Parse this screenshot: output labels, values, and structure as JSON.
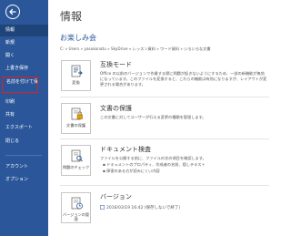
{
  "sidebar": {
    "items": [
      {
        "label": "情報"
      },
      {
        "label": "新規"
      },
      {
        "label": "開く"
      },
      {
        "label": "上書き保存"
      },
      {
        "label": "名前を付けて保存"
      },
      {
        "label": "印刷"
      },
      {
        "label": "共有"
      },
      {
        "label": "エクスポート"
      },
      {
        "label": "閉じる"
      },
      {
        "label": "アカウント"
      },
      {
        "label": "オプション"
      }
    ]
  },
  "main": {
    "title": "情報",
    "section_title": "お楽しみ会",
    "path": "C: » Users » yasukonatu » SkyDrive » レッスン資料 » ワード資料 » いろいろな文書",
    "compat": {
      "title": "互換モード",
      "button_label": "変換",
      "desc": "Office の以前のバージョンで作業する際に問題が起きないようにするため、一部の新機能が無効になっています。このファイルを変換すると、これらの機能は有効になりますが、レイアウトが変更される場合があります。"
    },
    "protect": {
      "title": "文書の保護",
      "button_label": "文書の保護",
      "desc": "この文書に対してユーザーが行える変更の種類を管理します。"
    },
    "inspect": {
      "title": "ドキュメント検査",
      "button_label": "問題のチェック",
      "desc": "ファイルを公開する前に、ファイルの次の項目を確認します。",
      "bullets": [
        "ドキュメントのプロパティ、作成者の名前、隠しテキスト",
        "障害のある方が読みにくい内容"
      ]
    },
    "version": {
      "title": "バージョン",
      "button_label": "バージョンの管理",
      "entry": "2016/03/19 16:42 (保存しないで終了)"
    }
  }
}
